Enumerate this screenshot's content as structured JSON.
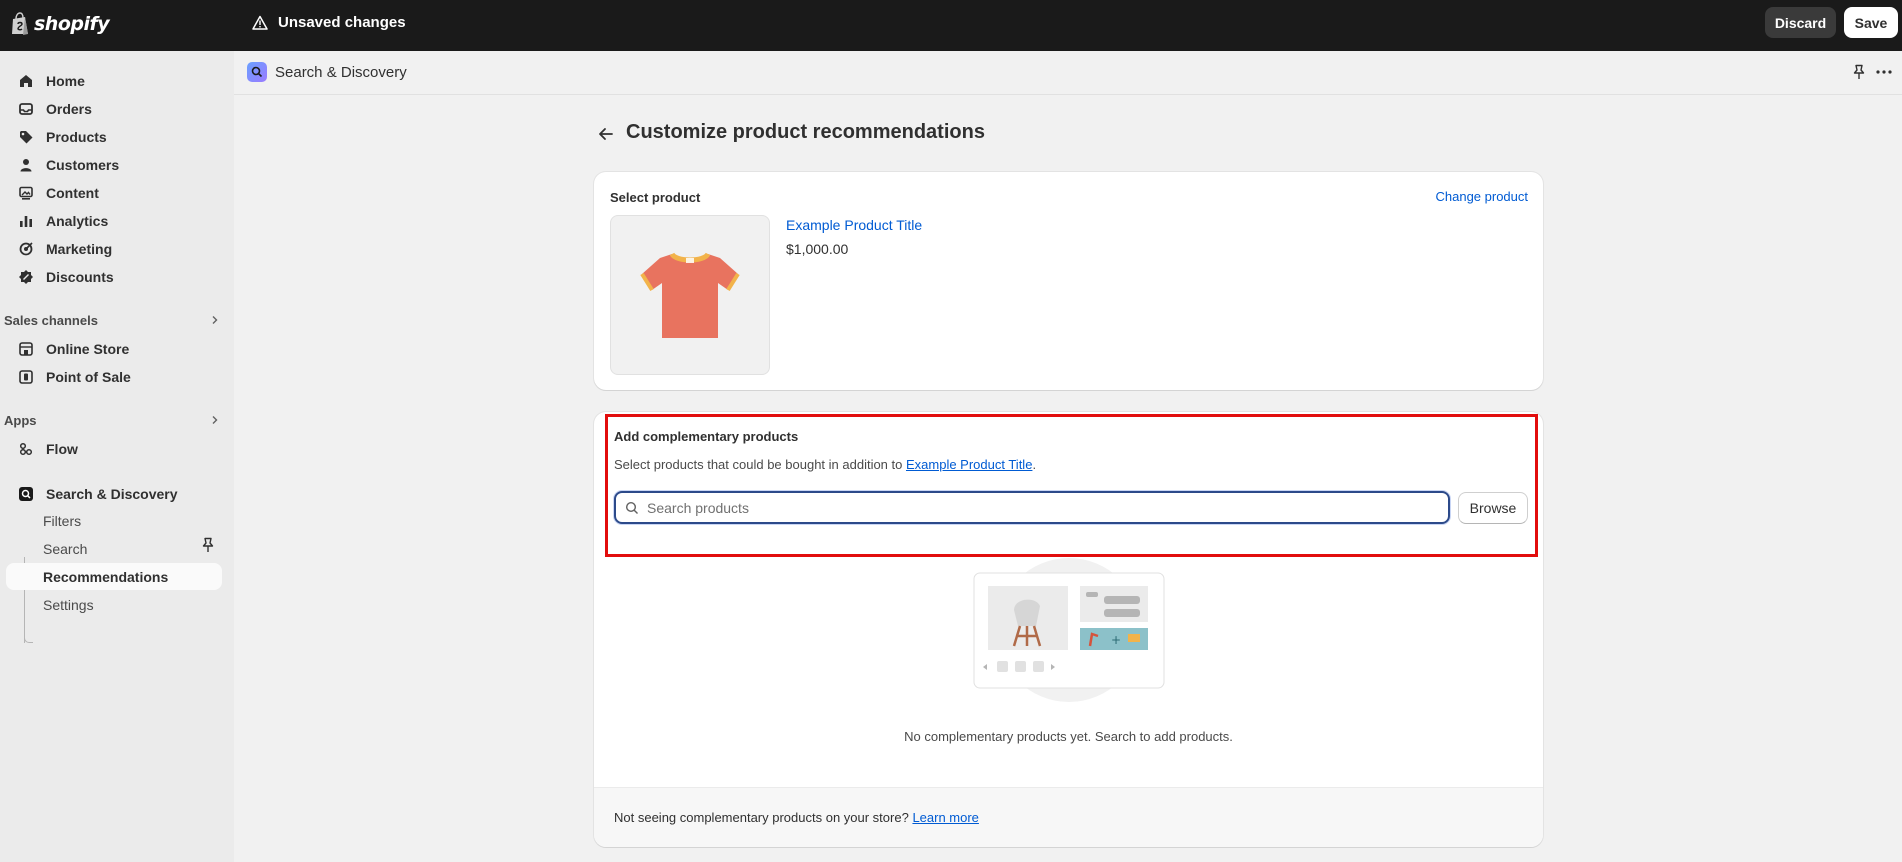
{
  "topbar": {
    "brand": "shopify",
    "status": "Unsaved changes",
    "discard_label": "Discard",
    "save_label": "Save"
  },
  "sidebar": {
    "items": [
      {
        "label": "Home",
        "icon": "home-icon"
      },
      {
        "label": "Orders",
        "icon": "inbox-icon"
      },
      {
        "label": "Products",
        "icon": "tag-icon"
      },
      {
        "label": "Customers",
        "icon": "person-icon"
      },
      {
        "label": "Content",
        "icon": "image-icon"
      },
      {
        "label": "Analytics",
        "icon": "bar-chart-icon"
      },
      {
        "label": "Marketing",
        "icon": "target-icon"
      },
      {
        "label": "Discounts",
        "icon": "discount-icon"
      }
    ],
    "sales_channels": {
      "heading": "Sales channels",
      "items": [
        {
          "label": "Online Store",
          "icon": "store-icon"
        },
        {
          "label": "Point of Sale",
          "icon": "pos-icon"
        }
      ]
    },
    "apps": {
      "heading": "Apps",
      "items": [
        {
          "label": "Flow",
          "icon": "flow-icon"
        },
        {
          "label": "Search & Discovery",
          "icon": "search-discovery-icon"
        }
      ],
      "sub_items": [
        {
          "label": "Filters"
        },
        {
          "label": "Search"
        },
        {
          "label": "Recommendations"
        },
        {
          "label": "Settings"
        }
      ]
    }
  },
  "appbar": {
    "app_name": "Search & Discovery"
  },
  "page": {
    "title": "Customize product recommendations"
  },
  "select_product": {
    "title": "Select product",
    "change_label": "Change product",
    "product_name": "Example Product Title",
    "product_price": "$1,000.00"
  },
  "complementary": {
    "title": "Add complementary products",
    "desc_prefix": "Select products that could be bought in addition to ",
    "desc_link": "Example Product Title",
    "desc_suffix": ".",
    "search_placeholder": "Search products",
    "browse_label": "Browse",
    "empty_text": "No complementary products yet. Search to add products.",
    "footer_prefix": "Not seeing complementary products on your store? ",
    "footer_link": "Learn more"
  },
  "colors": {
    "topbar_bg": "#1a1a1a",
    "link": "#005bd3",
    "highlight": "#e20d0d",
    "shirt": "#e8735f"
  }
}
